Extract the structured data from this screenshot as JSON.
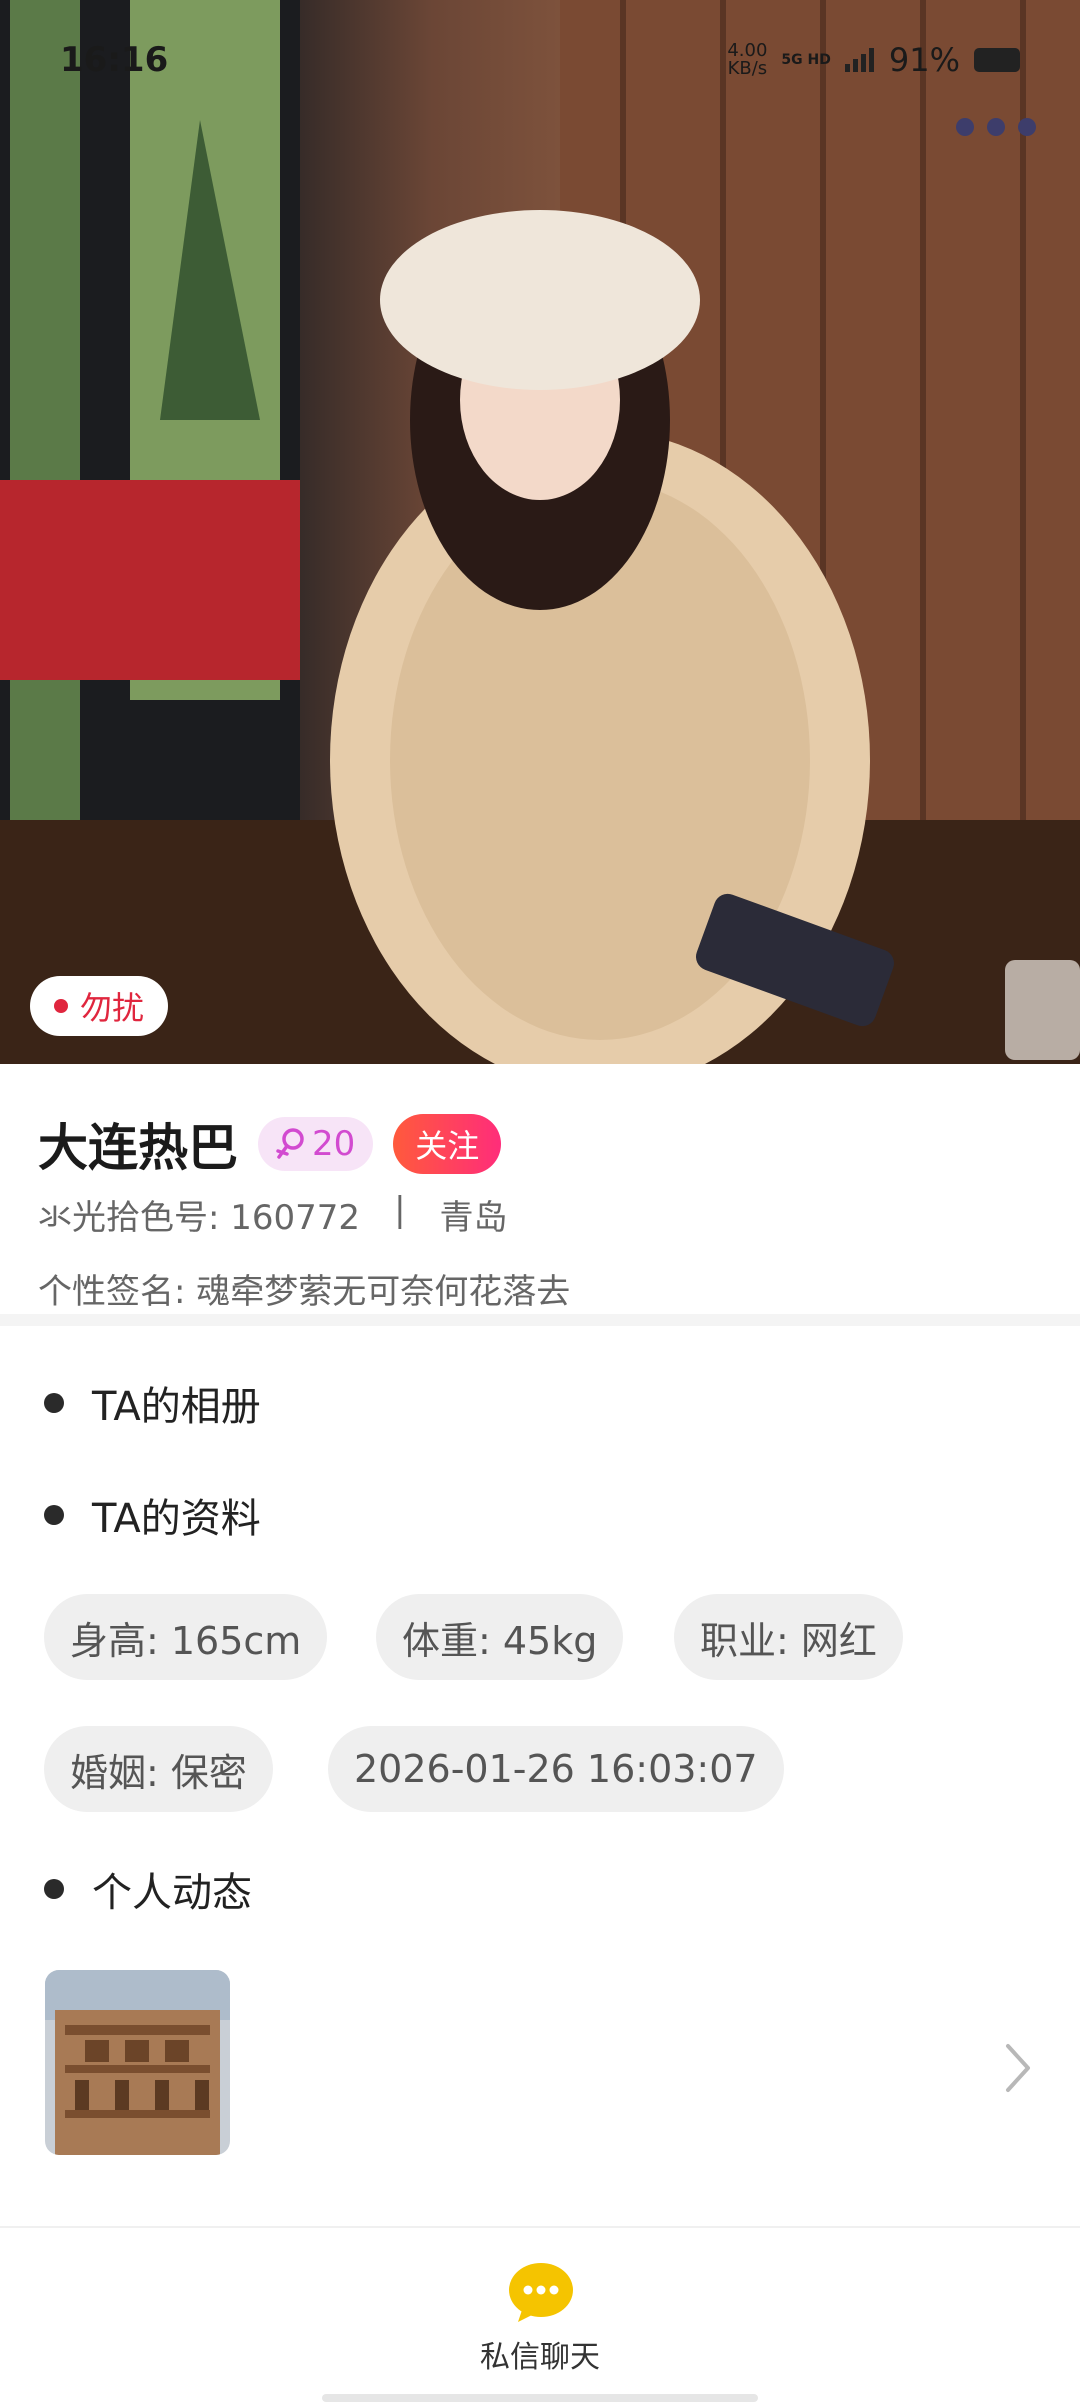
{
  "status_bar": {
    "time": "16:16",
    "net_speed_value": "4.00",
    "net_speed_unit": "KB/s",
    "signal_tags": "5G HD",
    "battery_percent": "91%"
  },
  "hero": {
    "dnd_label": "勿扰"
  },
  "profile": {
    "name": "大连热巴",
    "gender_age": "20",
    "follow_label": "关注",
    "id_text": "氺光拾色号: 160772",
    "separator": "|",
    "city": "青岛",
    "signature": "个性签名: 魂牵梦萦无可奈何花落去"
  },
  "sections": {
    "album_title": "TA的相册",
    "info_title": "TA的资料",
    "moments_title": "个人动态"
  },
  "info_tags": {
    "height": "身高: 165cm",
    "weight": "体重: 45kg",
    "job": "职业: 网红",
    "marriage": "婚姻: 保密",
    "datetime": "2026-01-26 16:03:07"
  },
  "bottom": {
    "chat_label": "私信聊天"
  },
  "colors": {
    "accent_red": "#e0263e",
    "follow_gradient_start": "#ff5a3c",
    "follow_gradient_end": "#ff2d7a",
    "gender_badge_bg": "#f7e4f7",
    "gender_badge_fg": "#d24bd0",
    "chat_icon": "#f5c400"
  },
  "icons": {
    "more": "more-dots-icon",
    "gender": "female-icon",
    "chat": "chat-bubble-icon",
    "chevron": "chevron-right-icon"
  }
}
